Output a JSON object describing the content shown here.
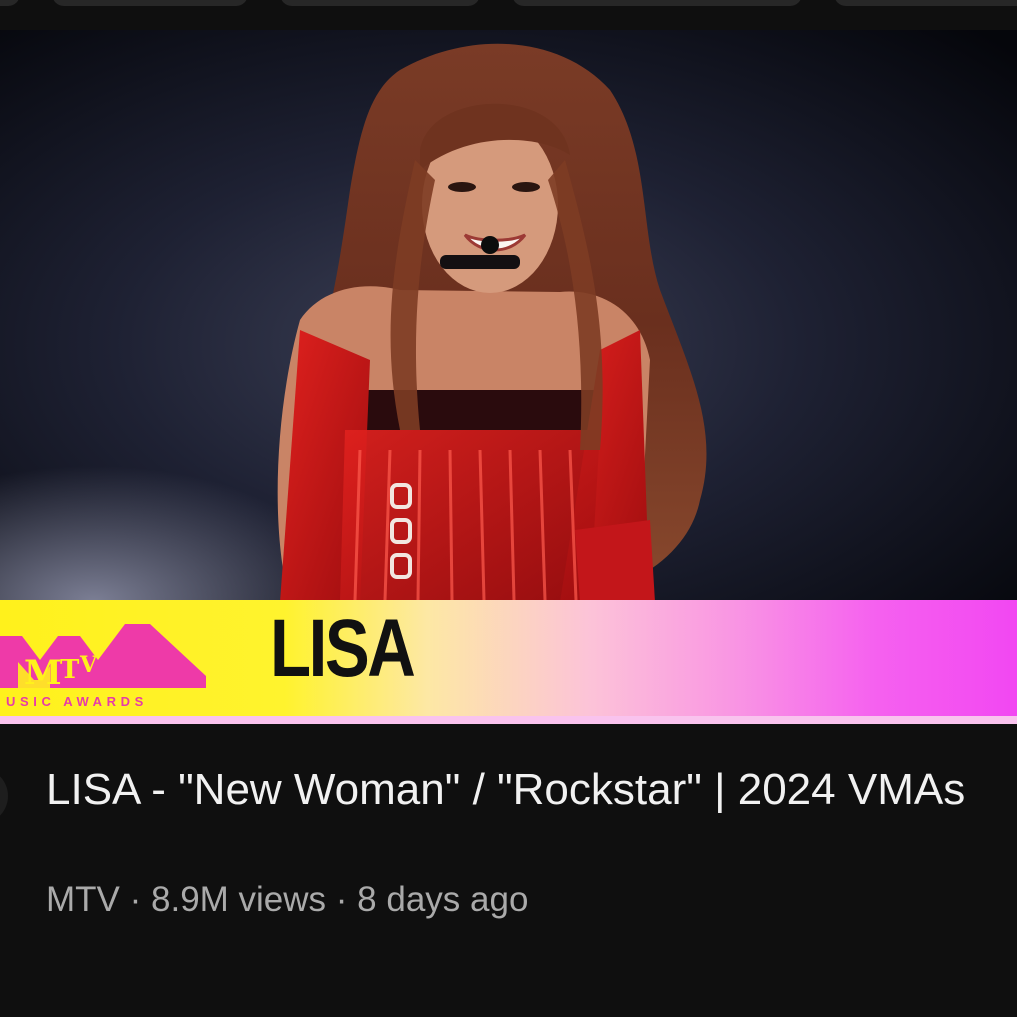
{
  "thumbnail": {
    "banner_name": "LISA",
    "logo_subtitle": "USIC AWARDS",
    "brand_colors": {
      "banner_yellow": "#fff11c",
      "banner_magenta": "#f247f2"
    }
  },
  "video": {
    "title": "LISA - \"New Woman\" / \"Rockstar\" | 2024 VMAs",
    "channel": "MTV",
    "separator": " · ",
    "views": "8.9M views",
    "age": "8 days ago"
  },
  "icons": [
    "channel-avatar-icon"
  ]
}
